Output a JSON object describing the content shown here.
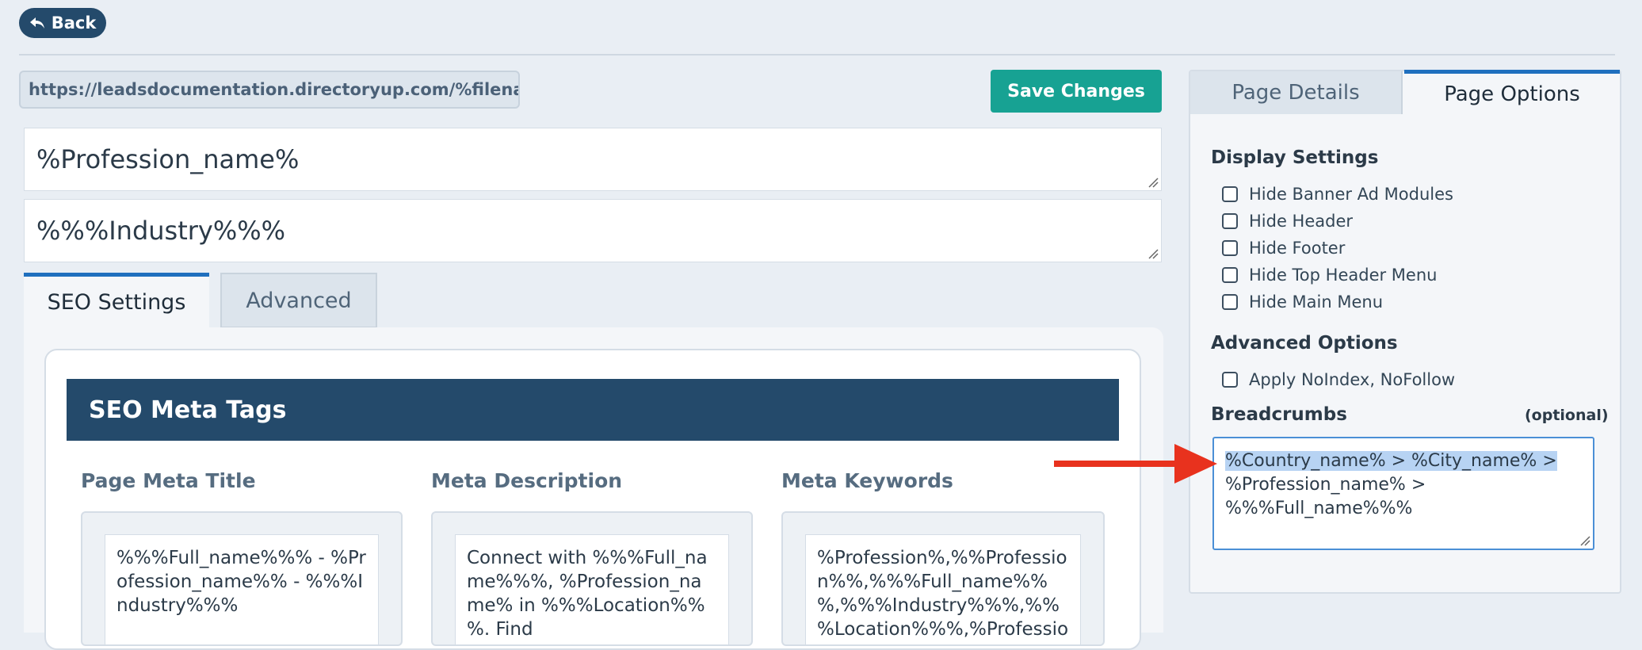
{
  "top": {
    "back_label": "Back"
  },
  "page": {
    "url": "https://leadsdocumentation.directoryup.com/%filename%",
    "save_label": "Save Changes",
    "profession_field": "%Profession_name%",
    "industry_field": "%%%Industry%%%"
  },
  "left_tabs": {
    "seo": "SEO Settings",
    "advanced": "Advanced"
  },
  "seo": {
    "header": "SEO Meta Tags",
    "title_label": "Page Meta Title",
    "title_value": "%%%Full_name%%% - %Profession_name%% - %%%Industry%%%",
    "description_label": "Meta Description",
    "description_value": "Connect with %%%Full_name%%%, %Profession_name% in %%%Location%%%. Find",
    "keywords_label": "Meta Keywords",
    "keywords_value": "%Profession%,%%Profession%%,%%%Full_name%%%,%%%Industry%%%,%%%Location%%%,%Profession_name%,%"
  },
  "right_tabs": {
    "details": "Page Details",
    "options": "Page Options"
  },
  "options": {
    "display_heading": "Display Settings",
    "display_items": [
      "Hide Banner Ad Modules",
      "Hide Header",
      "Hide Footer",
      "Hide Top Header Menu",
      "Hide Main Menu"
    ],
    "advanced_heading": "Advanced Options",
    "advanced_items": [
      "Apply NoIndex, NoFollow"
    ],
    "breadcrumbs_heading": "Breadcrumbs",
    "breadcrumbs_optional": "(optional)",
    "breadcrumbs_line1": "%Country_name% > %City_name% >",
    "breadcrumbs_line2": "%Profession_name% >",
    "breadcrumbs_line3": "%%%Full_name%%%"
  },
  "colors": {
    "navy": "#244a6b",
    "teal": "#17a293",
    "tab_accent": "#1f6fbe",
    "arrow": "#e8321e"
  }
}
